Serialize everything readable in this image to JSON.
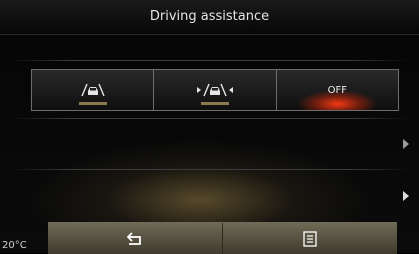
{
  "header": {
    "title": "Driving assistance"
  },
  "mode_selector": {
    "options": [
      {
        "icon": "lane-assist-car-icon",
        "label": ""
      },
      {
        "icon": "lane-keep-car-icon",
        "label": ""
      },
      {
        "icon": "",
        "label": "OFF"
      }
    ]
  },
  "bottom_bar": {
    "back_icon": "back-arrow-icon",
    "menu_icon": "menu-list-icon"
  },
  "status": {
    "temperature": "20°C"
  },
  "colors": {
    "accent": "#8c7a4e",
    "off_glow": "#ff3c14"
  }
}
